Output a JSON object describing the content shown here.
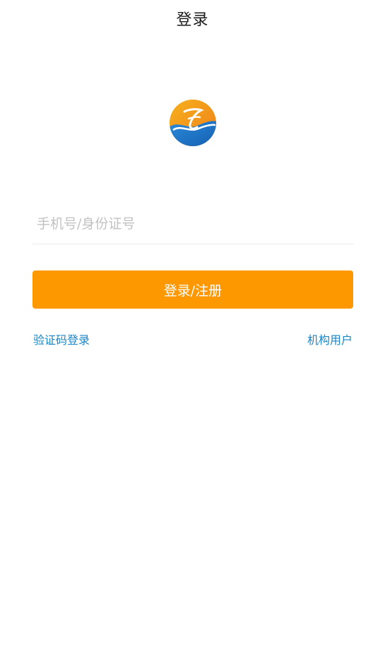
{
  "header": {
    "title": "登录"
  },
  "logo": {
    "icon": "brand-logo-icon",
    "colors": {
      "top": "#f39a1b",
      "bottom": "#1f72c5",
      "accent": "#ffffff"
    }
  },
  "form": {
    "account_placeholder": "手机号/身份证号",
    "account_value": "",
    "submit_label": "登录/注册"
  },
  "links": {
    "sms_login": "验证码登录",
    "org_user": "机构用户"
  },
  "colors": {
    "primary": "#fd9800",
    "link": "#1a86c6",
    "placeholder": "#c2c2c2",
    "divider": "#ececec"
  }
}
